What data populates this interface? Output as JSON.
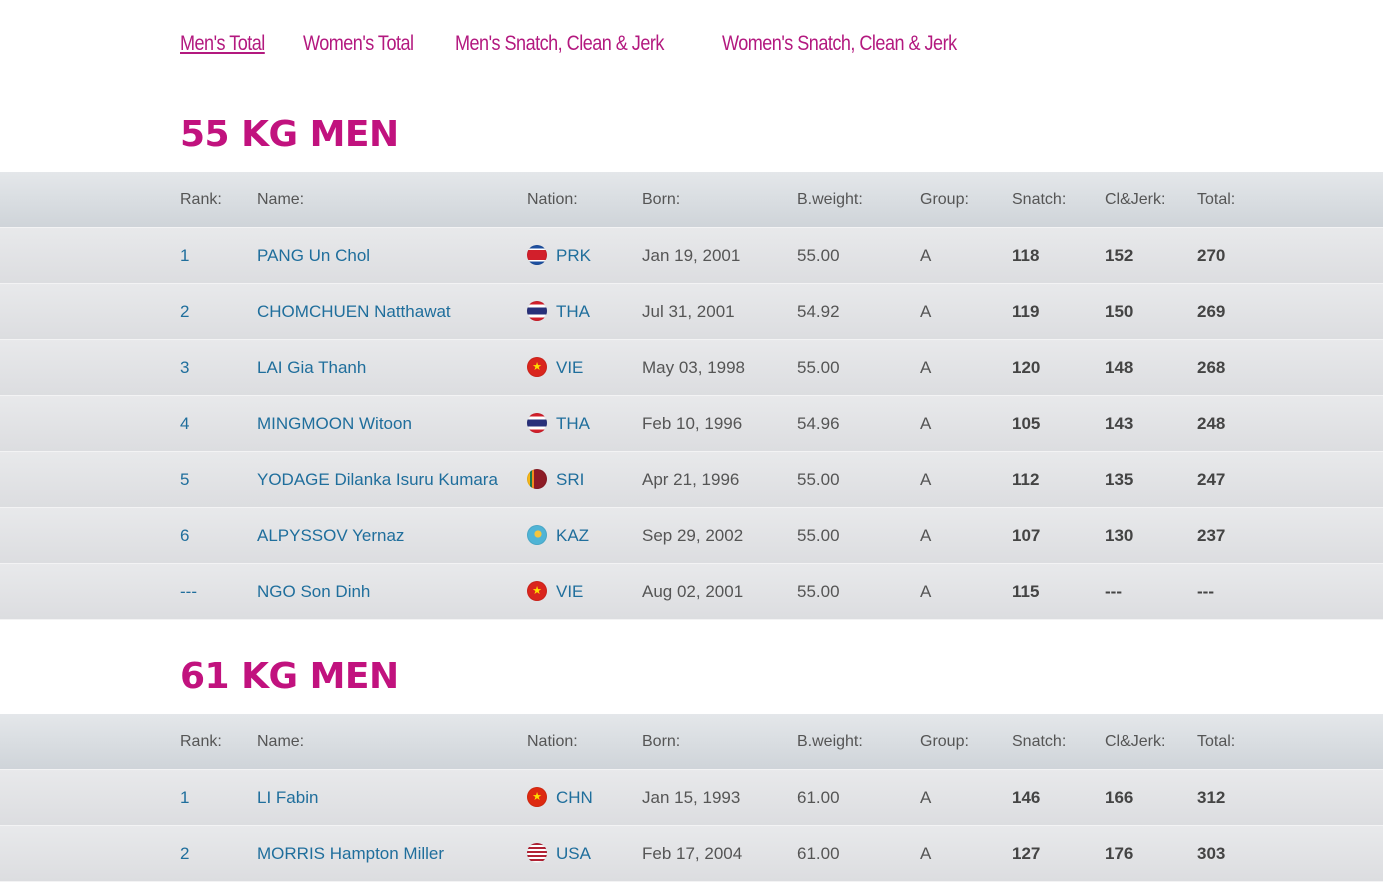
{
  "tabs": [
    {
      "label": "Men's Total",
      "active": true
    },
    {
      "label": "Women's Total",
      "active": false
    },
    {
      "label": "Men's Snatch, Clean & Jerk",
      "active": false
    },
    {
      "label": "Women's Snatch, Clean & Jerk",
      "active": false
    }
  ],
  "headers": {
    "rank": "Rank:",
    "name": "Name:",
    "nation": "Nation:",
    "born": "Born:",
    "bweight": "B.weight:",
    "group": "Group:",
    "snatch": "Snatch:",
    "cj": "Cl&Jerk:",
    "total": "Total:"
  },
  "colors": {
    "accent": "#c1127e",
    "link": "#1f6e9c"
  },
  "sections": [
    {
      "title": "55 KG MEN",
      "rows": [
        {
          "rank": "1",
          "name": "PANG Un Chol",
          "flag": "prk-flag-icon",
          "nation": "PRK",
          "born": "Jan 19, 2001",
          "bweight": "55.00",
          "group": "A",
          "snatch": "118",
          "cj": "152",
          "total": "270"
        },
        {
          "rank": "2",
          "name": "CHOMCHUEN Natthawat",
          "flag": "tha-flag-icon",
          "nation": "THA",
          "born": "Jul 31, 2001",
          "bweight": "54.92",
          "group": "A",
          "snatch": "119",
          "cj": "150",
          "total": "269"
        },
        {
          "rank": "3",
          "name": "LAI Gia Thanh",
          "flag": "vie-flag-icon",
          "nation": "VIE",
          "born": "May 03, 1998",
          "bweight": "55.00",
          "group": "A",
          "snatch": "120",
          "cj": "148",
          "total": "268"
        },
        {
          "rank": "4",
          "name": "MINGMOON Witoon",
          "flag": "tha-flag-icon",
          "nation": "THA",
          "born": "Feb 10, 1996",
          "bweight": "54.96",
          "group": "A",
          "snatch": "105",
          "cj": "143",
          "total": "248"
        },
        {
          "rank": "5",
          "name": "YODAGE Dilanka Isuru Kumara",
          "flag": "sri-flag-icon",
          "nation": "SRI",
          "born": "Apr 21, 1996",
          "bweight": "55.00",
          "group": "A",
          "snatch": "112",
          "cj": "135",
          "total": "247"
        },
        {
          "rank": "6",
          "name": "ALPYSSOV Yernaz",
          "flag": "kaz-flag-icon",
          "nation": "KAZ",
          "born": "Sep 29, 2002",
          "bweight": "55.00",
          "group": "A",
          "snatch": "107",
          "cj": "130",
          "total": "237"
        },
        {
          "rank": "---",
          "name": "NGO Son Dinh",
          "flag": "vie-flag-icon",
          "nation": "VIE",
          "born": "Aug 02, 2001",
          "bweight": "55.00",
          "group": "A",
          "snatch": "115",
          "cj": "---",
          "total": "---"
        }
      ]
    },
    {
      "title": "61 KG MEN",
      "rows": [
        {
          "rank": "1",
          "name": "LI Fabin",
          "flag": "chn-flag-icon",
          "nation": "CHN",
          "born": "Jan 15, 1993",
          "bweight": "61.00",
          "group": "A",
          "snatch": "146",
          "cj": "166",
          "total": "312"
        },
        {
          "rank": "2",
          "name": "MORRIS Hampton Miller",
          "flag": "usa-flag-icon",
          "nation": "USA",
          "born": "Feb 17, 2004",
          "bweight": "61.00",
          "group": "A",
          "snatch": "127",
          "cj": "176",
          "total": "303"
        }
      ]
    }
  ]
}
